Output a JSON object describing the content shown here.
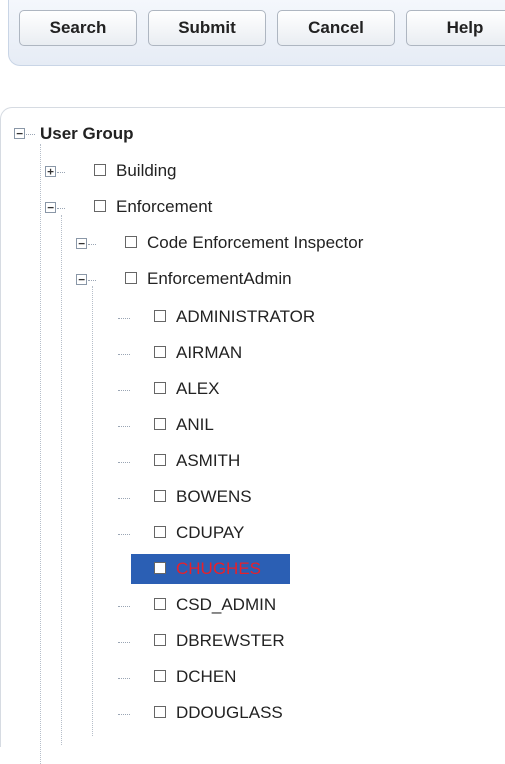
{
  "toolbar": {
    "search_label": "Search",
    "submit_label": "Submit",
    "cancel_label": "Cancel",
    "help_label": "Help"
  },
  "tree": {
    "root": {
      "label": "User Group",
      "expanded": true
    },
    "groups": [
      {
        "label": "Building",
        "expanded": false
      },
      {
        "label": "Enforcement",
        "expanded": true
      }
    ],
    "subgroups": [
      {
        "label": "Code Enforcement Inspector",
        "expanded": true
      },
      {
        "label": "EnforcementAdmin",
        "expanded": true
      }
    ],
    "users": [
      {
        "label": "ADMINISTRATOR"
      },
      {
        "label": "AIRMAN"
      },
      {
        "label": "ALEX"
      },
      {
        "label": "ANIL"
      },
      {
        "label": "ASMITH"
      },
      {
        "label": "BOWENS"
      },
      {
        "label": "CDUPAY"
      },
      {
        "label": "CHUGHES",
        "selected": true
      },
      {
        "label": "CSD_ADMIN"
      },
      {
        "label": "DBREWSTER"
      },
      {
        "label": "DCHEN"
      },
      {
        "label": "DDOUGLASS"
      }
    ],
    "selected_text_color": "#e8202a",
    "selected_bg_color": "#2b5fb4"
  }
}
